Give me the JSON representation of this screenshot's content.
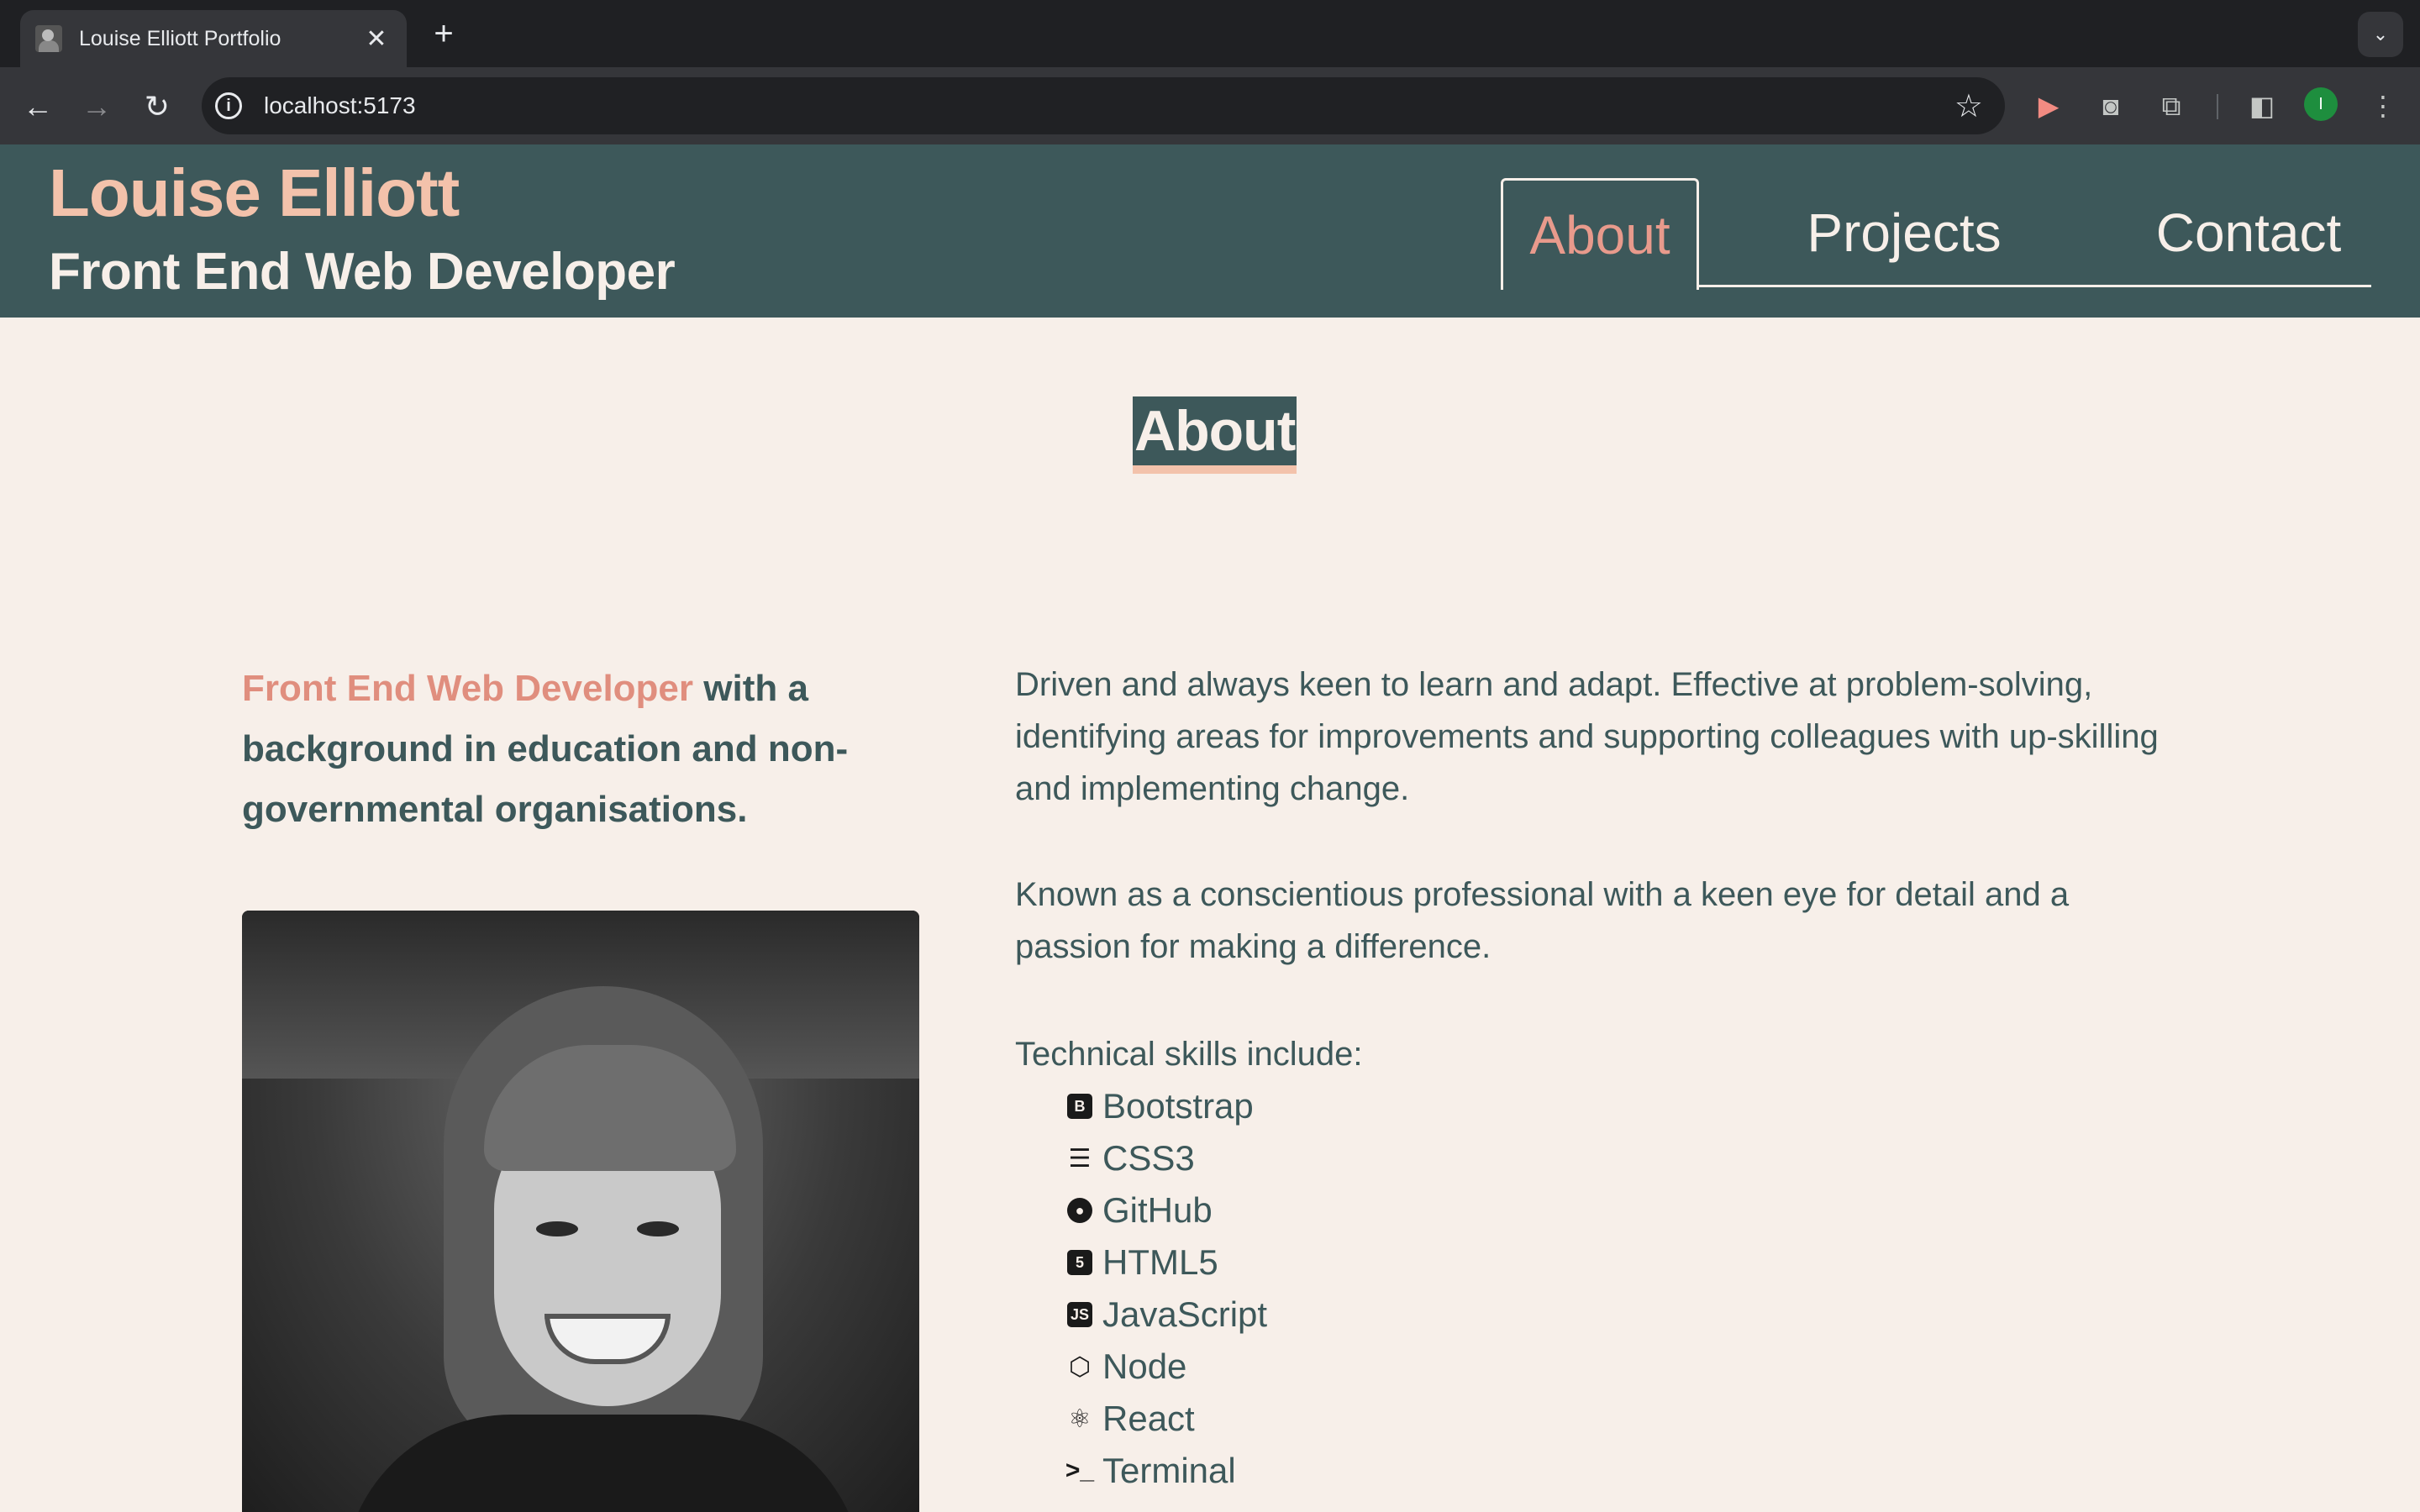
{
  "browser": {
    "tab_title": "Louise Elliott Portfolio",
    "tab_close": "✕",
    "new_tab": "+",
    "url": "localhost:5173",
    "profile_initial": "I"
  },
  "site": {
    "name": "Louise Elliott",
    "role": "Front End Web Developer",
    "nav": [
      {
        "label": "About",
        "active": true
      },
      {
        "label": "Projects",
        "active": false
      },
      {
        "label": "Contact",
        "active": false
      }
    ]
  },
  "about": {
    "title": "About",
    "intro_highlight": "Front End Web Developer",
    "intro_rest": " with a background in education and non-governmental organisations.",
    "paragraph1": "Driven and always keen to learn and adapt. Effective at problem-solving, identifying areas for improvements and supporting colleagues with up-skilling and implementing change.",
    "paragraph2": "Known as a conscientious professional with a keen eye for detail and a passion for making a difference.",
    "skills_label": "Technical skills include:",
    "skills": [
      {
        "name": "Bootstrap",
        "icon": "bootstrap-icon"
      },
      {
        "name": "CSS3",
        "icon": "css3-icon"
      },
      {
        "name": "GitHub",
        "icon": "github-icon"
      },
      {
        "name": "HTML5",
        "icon": "html5-icon"
      },
      {
        "name": "JavaScript",
        "icon": "javascript-icon"
      },
      {
        "name": "Node",
        "icon": "node-icon"
      },
      {
        "name": "React",
        "icon": "react-icon"
      },
      {
        "name": "Terminal",
        "icon": "terminal-icon"
      }
    ]
  },
  "colors": {
    "header_bg": "#3d585a",
    "page_bg": "#f7efe9",
    "accent_peach": "#f3c2ab",
    "accent_coral": "#e08e7e"
  }
}
